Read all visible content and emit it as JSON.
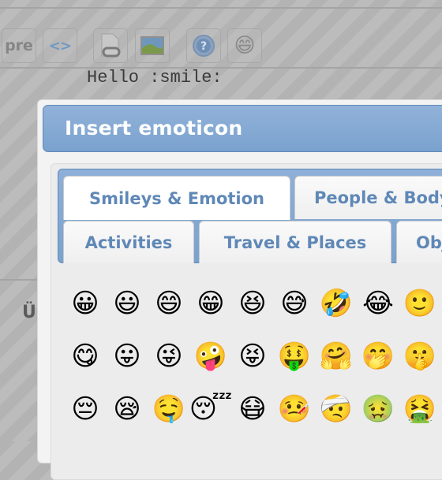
{
  "toolbar": {
    "buttons": [
      {
        "name": "pre",
        "label": "pre"
      },
      {
        "name": "code",
        "label": "<>"
      },
      {
        "name": "file-link",
        "label": "📄"
      },
      {
        "name": "image",
        "label": "🖼"
      },
      {
        "name": "help",
        "label": "?"
      },
      {
        "name": "emoticon",
        "label": "😄"
      }
    ]
  },
  "editor": {
    "text": "Hello :smile:",
    "lower_letter": "Ü"
  },
  "dialog": {
    "title": "Insert emoticon",
    "tabs": [
      {
        "label": "Smileys & Emotion",
        "active": true
      },
      {
        "label": "People & Body",
        "active": false
      },
      {
        "label": "Activities",
        "active": false
      },
      {
        "label": "Travel & Places",
        "active": false
      },
      {
        "label": "Objects",
        "active": false
      }
    ],
    "emoji_rows": [
      [
        "😀",
        "😃",
        "😄",
        "😁",
        "😆",
        "😅",
        "🤣",
        "😂",
        "🙂"
      ],
      [
        "😋",
        "😛",
        "😜",
        "🤪",
        "😝",
        "🤑",
        "🤗",
        "🤭",
        "🤫"
      ],
      [
        "😔",
        "😪",
        "🤤",
        "😴",
        "😷",
        "🤒",
        "🤕",
        "🤢",
        "🤮"
      ]
    ]
  }
}
